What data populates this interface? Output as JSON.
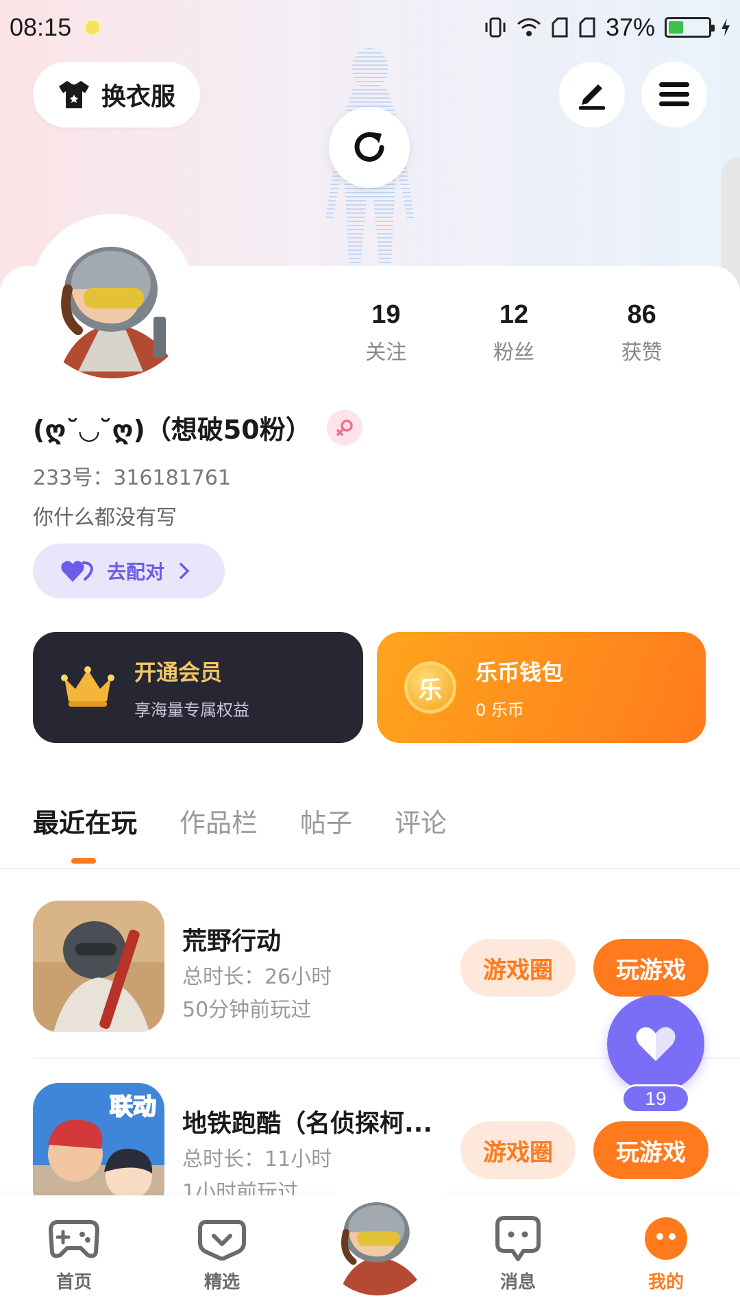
{
  "status_bar": {
    "time": "08:15",
    "battery": "37%",
    "battery_level": 0.37
  },
  "header": {
    "change_clothes_label": "换衣服"
  },
  "profile": {
    "stats": [
      {
        "value": "19",
        "label": "关注"
      },
      {
        "value": "12",
        "label": "粉丝"
      },
      {
        "value": "86",
        "label": "获赞"
      }
    ],
    "nickname": "(ღ˘◡˘ღ)（想破50粉）",
    "uid": "233号：316181761",
    "bio": "你什么都没有写",
    "match_label": "去配对"
  },
  "cards": {
    "vip": {
      "title": "开通会员",
      "subtitle": "享海量专属权益"
    },
    "wallet": {
      "title": "乐币钱包",
      "subtitle": "0 乐币",
      "coin_glyph": "乐"
    }
  },
  "tabs": [
    {
      "label": "最近在玩",
      "active": true
    },
    {
      "label": "作品栏",
      "active": false
    },
    {
      "label": "帖子",
      "active": false
    },
    {
      "label": "评论",
      "active": false
    }
  ],
  "games": [
    {
      "name": "荒野行动",
      "duration": "总时长：26小时",
      "last_played": "50分钟前玩过",
      "circle_label": "游戏圈",
      "play_label": "玩游戏"
    },
    {
      "name": "地铁跑酷（名侦探柯...",
      "duration": "总时长：11小时",
      "last_played": "1小时前玩过",
      "circle_label": "游戏圈",
      "play_label": "玩游戏",
      "badge": "联动"
    }
  ],
  "like_fab": {
    "count": "19"
  },
  "bottom_nav": [
    {
      "label": "首页",
      "icon": "gamepad-icon"
    },
    {
      "label": "精选",
      "icon": "heart-box-icon"
    },
    {
      "label": "消息",
      "icon": "chat-icon"
    },
    {
      "label": "我的",
      "icon": "face-icon",
      "active": true
    }
  ],
  "colors": {
    "accent": "#ff7a1c",
    "purple": "#7b6ef6",
    "vip_bg": "#272633",
    "vip_gold": "#f3c768"
  }
}
